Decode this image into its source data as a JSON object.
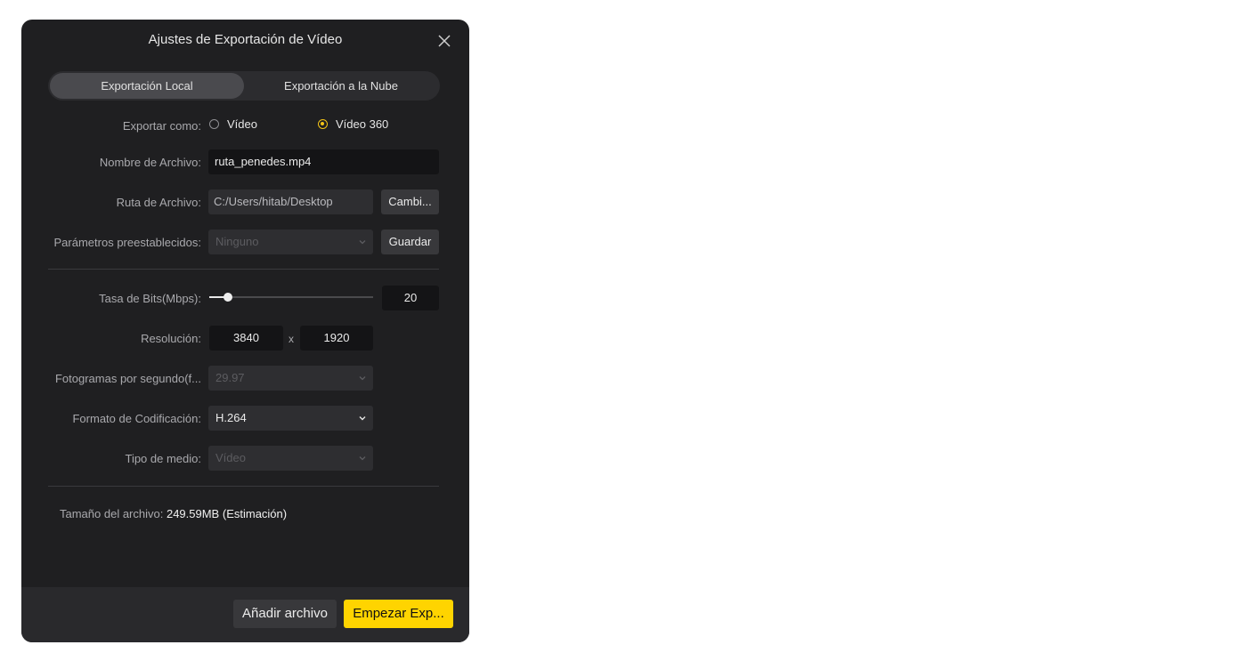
{
  "dialog": {
    "title": "Ajustes de Exportación de Vídeo",
    "close_icon": "close-icon"
  },
  "tabs": [
    {
      "label": "Exportación Local",
      "active": true
    },
    {
      "label": "Exportación a la Nube",
      "active": false
    }
  ],
  "export_as": {
    "label": "Exportar como:",
    "options": [
      {
        "label": "Vídeo",
        "selected": false
      },
      {
        "label": "Vídeo 360",
        "selected": true
      }
    ]
  },
  "file_name": {
    "label": "Nombre de Archivo:",
    "value": "ruta_penedes.mp4"
  },
  "file_path": {
    "label": "Ruta de Archivo:",
    "value": "C:/Users/hitab/Desktop",
    "button": "Cambi..."
  },
  "presets": {
    "label": "Parámetros preestablecidos:",
    "value": "Ninguno",
    "button": "Guardar"
  },
  "bitrate": {
    "label": "Tasa de Bits(Mbps):",
    "value": "20",
    "slider_fraction": 0.11
  },
  "resolution": {
    "label": "Resolución:",
    "width": "3840",
    "separator": "x",
    "height": "1920"
  },
  "fps": {
    "label": "Fotogramas por segundo(f...",
    "value": "29.97"
  },
  "codec": {
    "label": "Formato de Codificación:",
    "value": "H.264"
  },
  "media_type": {
    "label": "Tipo de medio:",
    "value": "Vídeo"
  },
  "file_size": {
    "label": "Tamaño del archivo:",
    "value": "249.59MB",
    "note": "(Estimación)"
  },
  "footer": {
    "add_file": "Añadir archivo",
    "start_export": "Empezar Exp..."
  },
  "colors": {
    "accent": "#ffd400",
    "background": "#1f1f21",
    "radio_selected": "#f5c518"
  }
}
